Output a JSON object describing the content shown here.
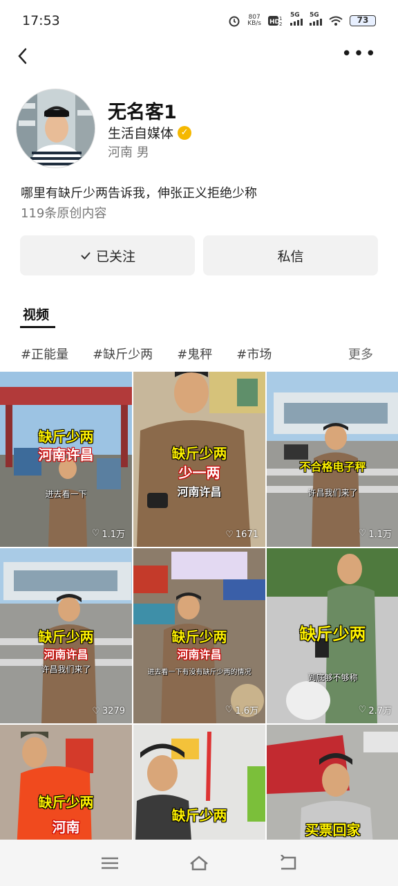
{
  "status_bar": {
    "time": "17:53",
    "net_speed_top": "807",
    "net_speed_bottom": "KB/s",
    "sim1": "5G",
    "sim2": "5G",
    "battery": "73"
  },
  "profile": {
    "name": "无名客1",
    "verify_label": "生活自媒体",
    "location": "河南 男",
    "bio": "哪里有缺斤少两告诉我，伸张正义拒绝少称",
    "original_count": "119条原创内容"
  },
  "actions": {
    "follow_label": "已关注",
    "message_label": "私信"
  },
  "tabs": {
    "video_label": "视频"
  },
  "tags": [
    "#正能量",
    "#缺斤少两",
    "#鬼秤",
    "#市场"
  ],
  "tags_more": "更多",
  "videos": [
    {
      "cap1": "缺斤少两",
      "cap2": "河南许昌",
      "sub": "进去看一下",
      "likes": "1.1万"
    },
    {
      "cap1": "缺斤少两",
      "cap2": "少一两",
      "sub": "河南许昌",
      "likes": "1671"
    },
    {
      "cap1": "不合格电子秤",
      "cap2": "",
      "sub": "许昌我们来了",
      "likes": "1.1万"
    },
    {
      "cap1": "缺斤少两",
      "cap2": "河南许昌",
      "sub": "许昌我们来了",
      "likes": "3279"
    },
    {
      "cap1": "缺斤少两",
      "cap2": "河南许昌",
      "sub": "进去看一下有没有缺斤少两的情况",
      "likes": "1.6万"
    },
    {
      "cap1": "缺斤少两",
      "cap2": "",
      "sub": "到底够不够称",
      "likes": "2.7万"
    },
    {
      "cap1": "缺斤少两",
      "cap2": "河南",
      "sub": "",
      "likes": ""
    },
    {
      "cap1": "缺斤少两",
      "cap2": "",
      "sub": "",
      "likes": ""
    },
    {
      "cap1": "买票回家",
      "cap2": "",
      "sub": "",
      "likes": ""
    }
  ],
  "colors": {
    "caption_yellow": "#fff200",
    "caption_red": "#cc0000",
    "verify_badge": "#f5b800"
  }
}
